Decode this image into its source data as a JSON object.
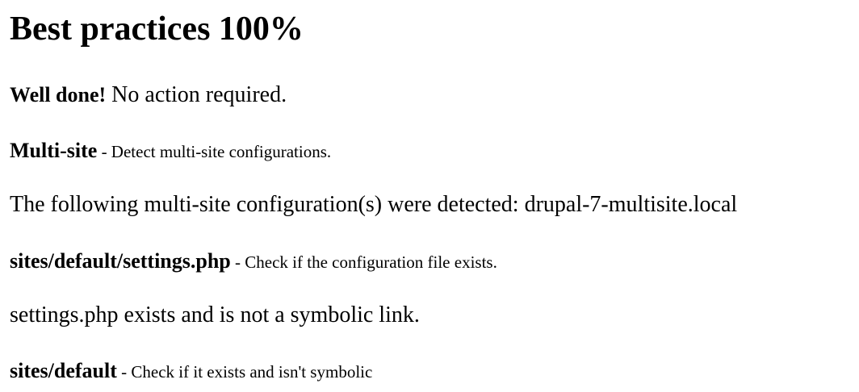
{
  "heading": "Best practices 100%",
  "summary": {
    "strong": "Well done!",
    "text": " No action required."
  },
  "checks": [
    {
      "name": "Multi-site",
      "description": " - Detect multi-site configurations.",
      "result": "The following multi-site configuration(s) were detected: drupal-7-multisite.local"
    },
    {
      "name": "sites/default/settings.php",
      "description": " - Check if the configuration file exists.",
      "result": "settings.php exists and is not a symbolic link."
    },
    {
      "name": "sites/default",
      "description": " - Check if it exists and isn't symbolic"
    }
  ]
}
